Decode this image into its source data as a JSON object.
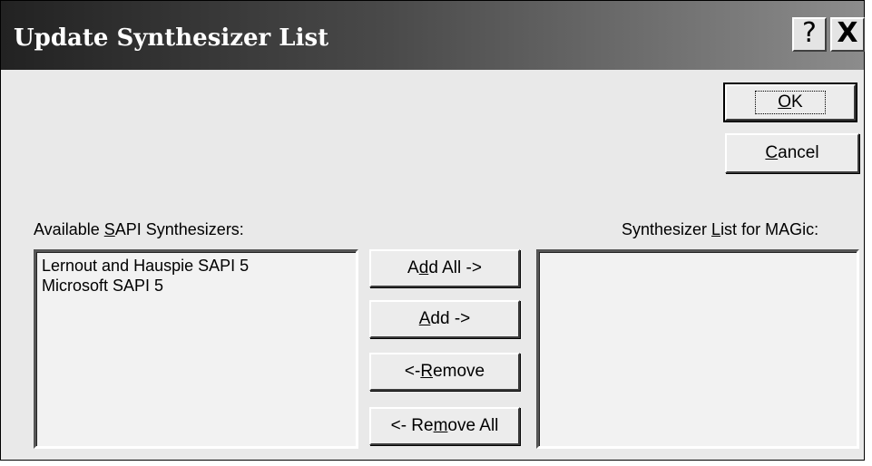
{
  "dialog": {
    "title": "Update Synthesizer List",
    "help_icon": "?",
    "close_icon": "X"
  },
  "buttons": {
    "ok_pre": "",
    "ok_key": "O",
    "ok_post": "K",
    "cancel_pre": "",
    "cancel_key": "C",
    "cancel_post": "ancel",
    "add_all_pre": "A",
    "add_all_key": "d",
    "add_all_post": "d All  ->",
    "add_pre": "",
    "add_key": "A",
    "add_post": "dd  ->",
    "remove_pre": "<-  ",
    "remove_key": "R",
    "remove_post": "emove",
    "remove_all_pre": "<-  Re",
    "remove_all_key": "m",
    "remove_all_post": "ove All"
  },
  "available": {
    "label_pre": "Available ",
    "label_key": "S",
    "label_post": "API Synthesizers:",
    "items": [
      "Lernout and Hauspie SAPI 5",
      "Microsoft SAPI 5"
    ]
  },
  "selected": {
    "label_pre": "Synthesizer ",
    "label_key": "L",
    "label_post": "ist for MAGic:",
    "items": []
  }
}
